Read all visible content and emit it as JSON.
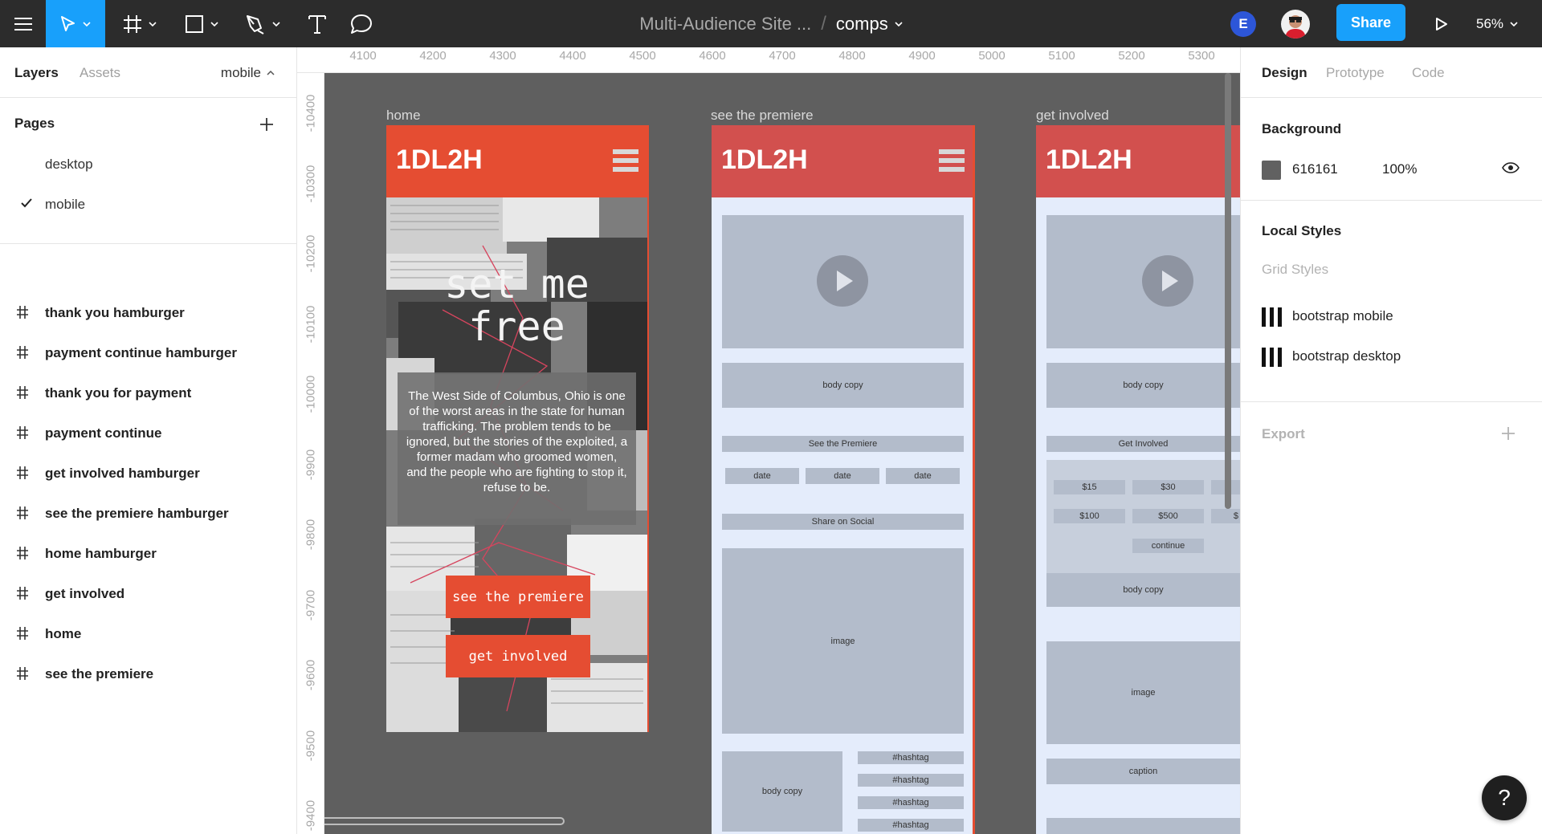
{
  "toolbar": {
    "file_name": "Multi-Audience Site ...",
    "separator": "/",
    "page_name": "comps",
    "avatar_initial": "E",
    "share_label": "Share",
    "zoom": "56%",
    "icons": [
      "menu-icon",
      "move-tool-icon",
      "frame-tool-icon",
      "shape-tool-icon",
      "pen-tool-icon",
      "text-tool-icon",
      "comment-tool-icon",
      "present-icon"
    ]
  },
  "left_panel": {
    "tabs": [
      "Layers",
      "Assets"
    ],
    "page_selector": "mobile",
    "pages_header": "Pages",
    "pages": [
      {
        "label": "desktop",
        "selected": false
      },
      {
        "label": "mobile",
        "selected": true
      }
    ],
    "layers": [
      "thank you hamburger",
      "payment continue hamburger",
      "thank you for payment",
      "payment continue",
      "get involved hamburger",
      "see the premiere hamburger",
      "home hamburger",
      "get involved",
      "home",
      "see the premiere"
    ]
  },
  "canvas": {
    "background": "#616161",
    "ruler_x": [
      "4100",
      "4200",
      "4300",
      "4400",
      "4500",
      "4600",
      "4700",
      "4800",
      "4900",
      "5000",
      "5100",
      "5200",
      "5300"
    ],
    "ruler_y": [
      "-10400",
      "-10300",
      "-10200",
      "-10100",
      "-10000",
      "-9900",
      "-9800",
      "-9700",
      "-9600",
      "-9500",
      "-9400"
    ],
    "brand_color": "#e54d32",
    "frames": {
      "home": {
        "label": "home",
        "logo": "1DL2H",
        "hero_title_1": "set me",
        "hero_title_2": "free",
        "hero_copy": "The West Side of Columbus, Ohio is one of the worst areas in the state for human trafficking. The problem tends to be ignored, but the stories of the exploited, a former madam who groomed women, and the people who are fighting to stop it, refuse to be.",
        "btn_premiere": "see the premiere",
        "btn_involved": "get involved"
      },
      "premiere": {
        "label": "see the premiere",
        "logo": "1DL2H",
        "body_copy": "body copy",
        "section_btn": "See the Premiere",
        "date_1": "date",
        "date_2": "date",
        "date_3": "date",
        "share": "Share on Social",
        "image": "image",
        "body_copy_2": "body copy",
        "hashtag_1": "#hashtag",
        "hashtag_2": "#hashtag",
        "hashtag_3": "#hashtag",
        "hashtag_4": "#hashtag"
      },
      "involved": {
        "label": "get involved",
        "logo": "1DL2H",
        "body_copy": "body copy",
        "section_btn": "Get Involved",
        "amount_1": "$15",
        "amount_2": "$30",
        "amount_3": "$100",
        "amount_4": "$500",
        "amount_5": "$",
        "continue": "continue",
        "body_copy_2": "body copy",
        "image": "image",
        "caption": "caption"
      }
    }
  },
  "right_panel": {
    "tabs": [
      "Design",
      "Prototype",
      "Code"
    ],
    "background_header": "Background",
    "background_hex": "616161",
    "background_opacity": "100%",
    "local_styles_header": "Local Styles",
    "grid_styles_header": "Grid Styles",
    "grid_styles": [
      "bootstrap mobile",
      "bootstrap desktop"
    ],
    "export_header": "Export"
  },
  "help_label": "?"
}
